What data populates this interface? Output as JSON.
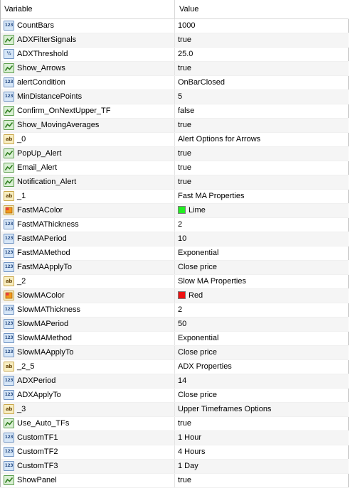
{
  "header": {
    "variable": "Variable",
    "value": "Value"
  },
  "colors": {
    "Lime": "#22ee22",
    "Red": "#ee1111"
  },
  "rows": [
    {
      "icon": "int",
      "name": "CountBars",
      "value": "1000"
    },
    {
      "icon": "bool",
      "name": "ADXFilterSignals",
      "value": "true"
    },
    {
      "icon": "dbl",
      "name": "ADXThreshold",
      "value": "25.0"
    },
    {
      "icon": "bool",
      "name": "Show_Arrows",
      "value": "true"
    },
    {
      "icon": "int",
      "name": "alertCondition",
      "value": "OnBarClosed"
    },
    {
      "icon": "int",
      "name": "MinDistancePoints",
      "value": "5"
    },
    {
      "icon": "bool",
      "name": "Confirm_OnNextUpper_TF",
      "value": "false"
    },
    {
      "icon": "bool",
      "name": "Show_MovingAverages",
      "value": "true"
    },
    {
      "icon": "str",
      "name": "_0",
      "value": "Alert Options for Arrows"
    },
    {
      "icon": "bool",
      "name": "PopUp_Alert",
      "value": "true"
    },
    {
      "icon": "bool",
      "name": "Email_Alert",
      "value": "true"
    },
    {
      "icon": "bool",
      "name": "Notification_Alert",
      "value": "true"
    },
    {
      "icon": "str",
      "name": "_1",
      "value": "Fast MA Properties"
    },
    {
      "icon": "col",
      "name": "FastMAColor",
      "value": "Lime",
      "swatch": "Lime"
    },
    {
      "icon": "int",
      "name": "FastMAThickness",
      "value": "2"
    },
    {
      "icon": "int",
      "name": "FastMAPeriod",
      "value": "10"
    },
    {
      "icon": "int",
      "name": "FastMAMethod",
      "value": "Exponential"
    },
    {
      "icon": "int",
      "name": "FastMAApplyTo",
      "value": "Close price"
    },
    {
      "icon": "str",
      "name": "_2",
      "value": "Slow MA Properties"
    },
    {
      "icon": "col",
      "name": "SlowMAColor",
      "value": "Red",
      "swatch": "Red"
    },
    {
      "icon": "int",
      "name": "SlowMAThickness",
      "value": "2"
    },
    {
      "icon": "int",
      "name": "SlowMAPeriod",
      "value": "50"
    },
    {
      "icon": "int",
      "name": "SlowMAMethod",
      "value": "Exponential"
    },
    {
      "icon": "int",
      "name": "SlowMAApplyTo",
      "value": "Close price"
    },
    {
      "icon": "str",
      "name": "_2_5",
      "value": "ADX Properties"
    },
    {
      "icon": "int",
      "name": "ADXPeriod",
      "value": "14"
    },
    {
      "icon": "int",
      "name": "ADXApplyTo",
      "value": "Close price"
    },
    {
      "icon": "str",
      "name": "_3",
      "value": "Upper Timeframes Options"
    },
    {
      "icon": "bool",
      "name": "Use_Auto_TFs",
      "value": "true"
    },
    {
      "icon": "int",
      "name": "CustomTF1",
      "value": "1 Hour"
    },
    {
      "icon": "int",
      "name": "CustomTF2",
      "value": "4 Hours"
    },
    {
      "icon": "int",
      "name": "CustomTF3",
      "value": "1 Day"
    },
    {
      "icon": "bool",
      "name": "ShowPanel",
      "value": "true"
    }
  ]
}
